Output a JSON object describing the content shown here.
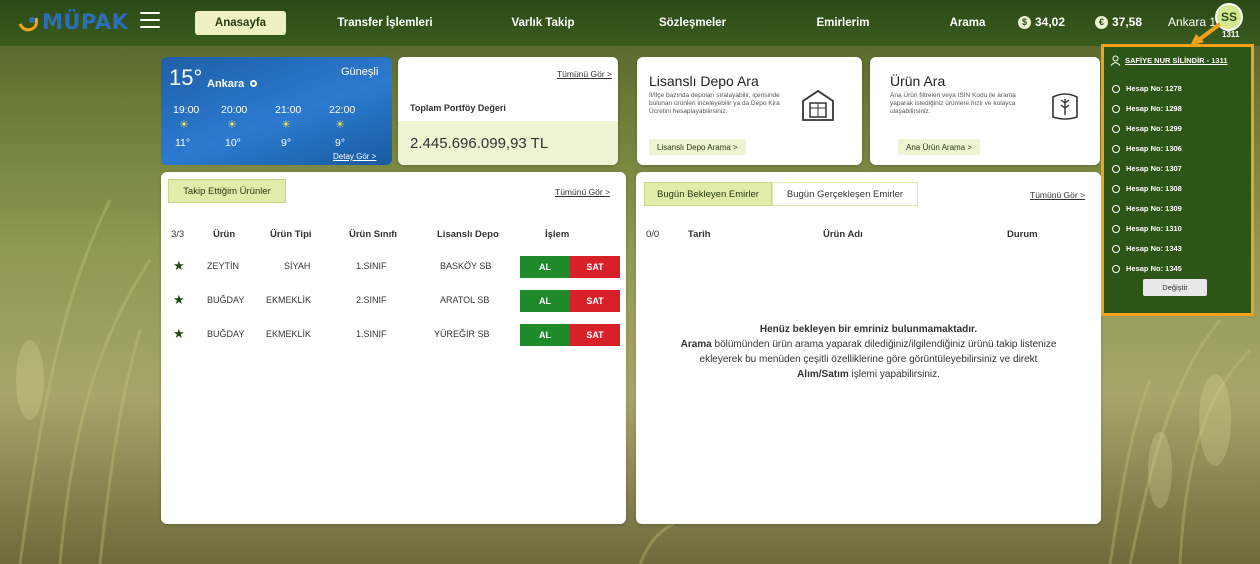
{
  "brand": {
    "logo_text": "MÜPAK"
  },
  "nav": {
    "home": "Anasayfa",
    "items": [
      "Transfer İşlemleri",
      "Varlık Takip",
      "Sözleşmeler",
      "Emirlerim",
      "Arama"
    ]
  },
  "header": {
    "usd": "34,02",
    "eur": "37,58",
    "usd_icon": "dollar-icon",
    "eur_icon": "euro-icon",
    "city_temp": "Ankara 15°",
    "avatar_initials": "SS",
    "account_no": "1311"
  },
  "weather": {
    "temp": "15°",
    "city": "Ankara",
    "condition": "Güneşli",
    "hours": [
      "19:00",
      "20:00",
      "21:00",
      "22:00"
    ],
    "temps": [
      "11°",
      "10°",
      "9°",
      "9°"
    ],
    "detail_link": "Detay Gör >"
  },
  "portfolio": {
    "see_all": "Tümünü Gör >",
    "title": "Toplam Portföy Değeri",
    "value": "2.445.696.099,93 TL"
  },
  "depo_search": {
    "title": "Lisanslı Depo Ara",
    "description": "İl/İlçe bazında depoları sıralayabilir, içerisinde bulunan ürünleri inceleyebilir ya da Depo Kira Ücretini hesaplayabilirsiniz.",
    "button": "Lisanslı Depo Arama >"
  },
  "product_search": {
    "title": "Ürün Ara",
    "description": "Ana Ürün filtreleri veya ISIN Kodu ile arama yaparak istediğiniz ürünlere hızlı ve kolayca ulaşabilirsiniz.",
    "button": "Ana Ürün Arama >"
  },
  "tracked": {
    "tab": "Takip Ettiğim Ürünler",
    "see_all": "Tümünü Gör >",
    "count": "3/3",
    "columns": [
      "Ürün",
      "Ürün Tipi",
      "Ürün Sınıfı",
      "Lisanslı Depo",
      "İşlem"
    ],
    "rows": [
      {
        "product": "ZEYTİN",
        "type": "SİYAH",
        "class": "1.SINIF",
        "depot": "BASKÖY SB"
      },
      {
        "product": "BUĞDAY",
        "type": "EKMEKLİK",
        "class": "2.SINIF",
        "depot": "ARATOL SB"
      },
      {
        "product": "BUĞDAY",
        "type": "EKMEKLİK",
        "class": "1.SINIF",
        "depot": "YÜREĞİR SB"
      }
    ],
    "buy": "AL",
    "sell": "SAT"
  },
  "orders": {
    "tab_active": "Bugün Bekleyen Emirler",
    "tab_other": "Bugün Gerçekleşen Emirler",
    "see_all": "Tümünü Gör >",
    "count": "0/0",
    "columns": [
      "Tarih",
      "Ürün Adı",
      "Durum"
    ],
    "empty_title": "Henüz bekleyen bir emriniz bulunmamaktadır.",
    "empty_line1_bold": "Arama",
    "empty_line1": " bölümünden ürün arama yaparak dilediğiniz/ilgilendiğiniz ürünü takip listenize",
    "empty_line2": "ekleyerek bu menüden çeşitli özelliklerine göre görüntüleyebilirsiniz ve direkt",
    "empty_line3_bold": "Alım/Satım",
    "empty_line3": " işlemi yapabilirsiniz."
  },
  "accounts": {
    "user": "SAFİYE NUR SİLİNDİR - 1311",
    "items": [
      "Hesap No: 1278",
      "Hesap No: 1298",
      "Hesap No: 1299",
      "Hesap No: 1306",
      "Hesap No: 1307",
      "Hesap No: 1308",
      "Hesap No: 1309",
      "Hesap No: 1310",
      "Hesap No: 1343",
      "Hesap No: 1345"
    ],
    "button": "Değiştir"
  },
  "colors": {
    "accent_green": "#2d5517",
    "highlight_orange": "#f2a11a",
    "buy_green": "#1e8a2a",
    "sell_red": "#d8202a"
  }
}
